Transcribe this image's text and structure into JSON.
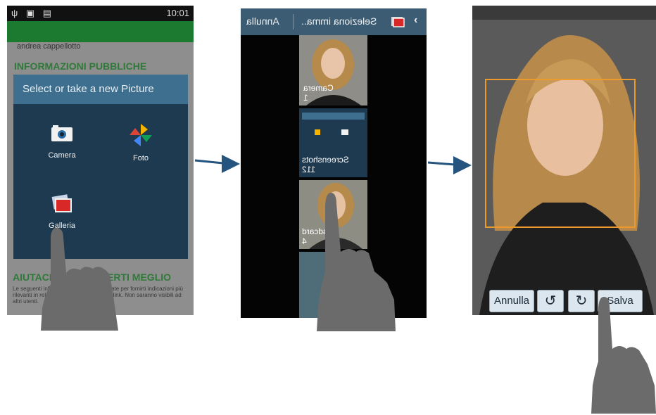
{
  "panel1": {
    "status_time": "10:01",
    "contact_name": "andrea cappellotto",
    "section_info": "INFORMAZIONI PUBBLICHE",
    "dialog": {
      "title": "Select or take a new Picture",
      "options": [
        {
          "label": "Camera",
          "icon": "camera-icon"
        },
        {
          "label": "Foto",
          "icon": "pinwheel-icon"
        },
        {
          "label": "Galleria",
          "icon": "gallery-icon"
        }
      ]
    },
    "help_title": "AIUTACI A CONOSCERTI MEGLIO",
    "help_text": "Le seguenti informazioni saranno utilizzate per fornirti indicazioni più rilevanti in relazione al contenuto di famiIink. Non saranno visibili ad altri utenti."
  },
  "panel2": {
    "title": "Seleziona imma..",
    "cancel": "Annulla",
    "back_icon": "chevron-left-icon",
    "albums": [
      {
        "name": "Camera",
        "count": "1"
      },
      {
        "name": "Screenshots",
        "count": "112"
      },
      {
        "name": "sdcard",
        "count": "4"
      }
    ]
  },
  "panel3": {
    "buttons": {
      "cancel": "Annulla",
      "save": "Salva"
    },
    "crop_color": "#ee9a2a"
  },
  "colors": {
    "arrow": "#25547f",
    "dialog_bg": "#1d3a50",
    "dialog_header": "#3f6f8e",
    "green_accent": "#2f7a38"
  }
}
